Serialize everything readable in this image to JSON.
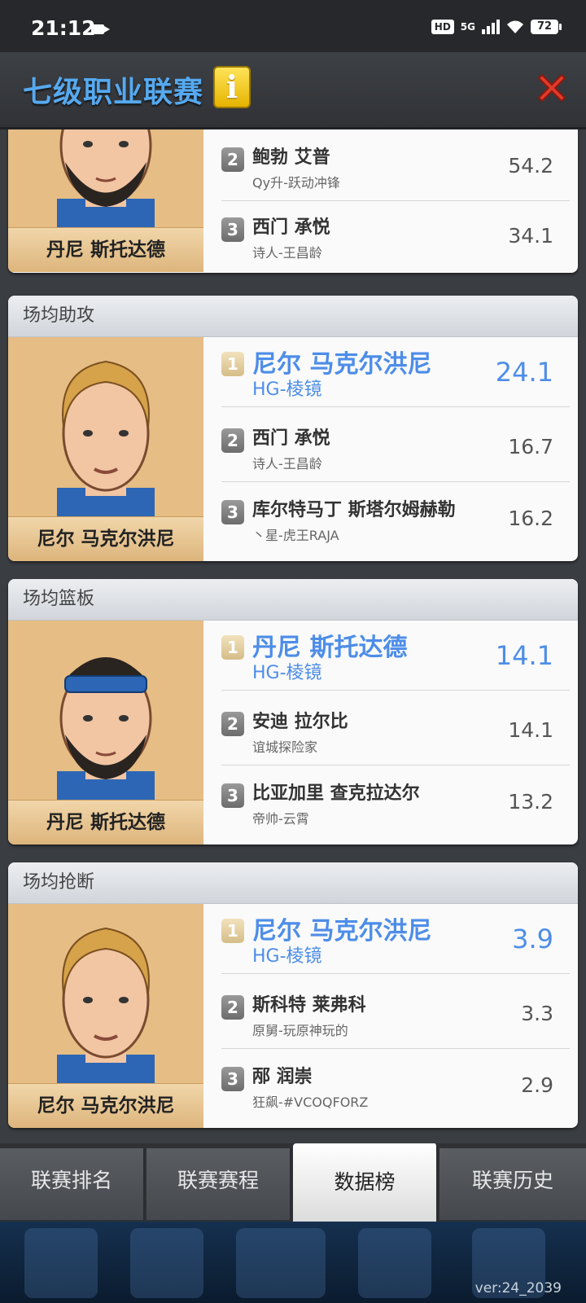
{
  "status_bar": {
    "time": "21:12",
    "hd": "HD",
    "network": "5G",
    "battery": "72"
  },
  "header": {
    "title": "七级职业联赛",
    "info_icon": "i"
  },
  "cards": [
    {
      "section": "",
      "leader_name": "丹尼 斯托达德",
      "rows": [
        {
          "rank": "2",
          "name": "鲍勃 艾普",
          "team": "Qy升-跃动冲锋",
          "value": "54.2"
        },
        {
          "rank": "3",
          "name": "西门 承悦",
          "team": "诗人-王昌龄",
          "value": "34.1"
        }
      ]
    },
    {
      "section": "场均助攻",
      "leader_name": "尼尔 马克尔洪尼",
      "rows": [
        {
          "rank": "1",
          "name": "尼尔 马克尔洪尼",
          "team": "HG-棱镜",
          "value": "24.1"
        },
        {
          "rank": "2",
          "name": "西门 承悦",
          "team": "诗人-王昌龄",
          "value": "16.7"
        },
        {
          "rank": "3",
          "name": "库尔特马丁 斯塔尔姆赫勒",
          "team": "丶星-虎王RAJA",
          "value": "16.2"
        }
      ]
    },
    {
      "section": "场均篮板",
      "leader_name": "丹尼 斯托达德",
      "rows": [
        {
          "rank": "1",
          "name": "丹尼 斯托达德",
          "team": "HG-棱镜",
          "value": "14.1"
        },
        {
          "rank": "2",
          "name": "安迪 拉尔比",
          "team": "谊城探险家",
          "value": "14.1"
        },
        {
          "rank": "3",
          "name": "比亚加里 查克拉达尔",
          "team": "帝帅-云霄",
          "value": "13.2"
        }
      ]
    },
    {
      "section": "场均抢断",
      "leader_name": "尼尔 马克尔洪尼",
      "rows": [
        {
          "rank": "1",
          "name": "尼尔 马克尔洪尼",
          "team": "HG-棱镜",
          "value": "3.9"
        },
        {
          "rank": "2",
          "name": "斯科特 莱弗科",
          "team": "原舅-玩原神玩的",
          "value": "3.3"
        },
        {
          "rank": "3",
          "name": "邴 润崇",
          "team": "狂飙-#VCOQFORZ",
          "value": "2.9"
        }
      ]
    }
  ],
  "tabs": [
    {
      "label": "联赛排名",
      "active": false
    },
    {
      "label": "联赛赛程",
      "active": false
    },
    {
      "label": "数据榜",
      "active": true
    },
    {
      "label": "联赛历史",
      "active": false
    }
  ],
  "version": "ver:24_2039",
  "colors": {
    "accent_blue": "#4d8de8",
    "title_blue": "#56a9f0",
    "leader_bg": "#e6bd84"
  }
}
